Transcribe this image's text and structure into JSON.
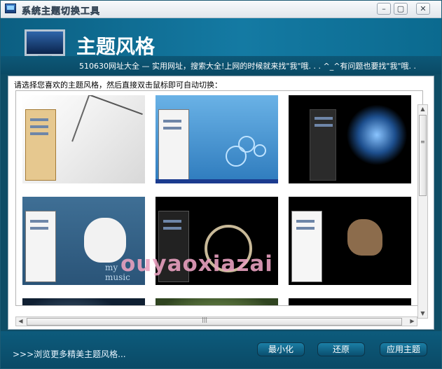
{
  "window": {
    "title": "系统主题切换工具",
    "controls": {
      "minimize": "–",
      "restore": "▢",
      "close": "✕"
    }
  },
  "header": {
    "heading": "主题风格",
    "marquee": "510630网址大全 — 实用网址，搜索大全!上网的时候就来找\"我\"哦. . . ^_^有问题也要找\"我\"哦. .",
    "icon": "monitor-icon"
  },
  "main": {
    "instruction": "请选择您喜欢的主题风格，然后直接双击鼠标即可自动切换：",
    "themes": [
      {
        "name": "theme-ink-painting"
      },
      {
        "name": "theme-blue-bubbles"
      },
      {
        "name": "theme-earth-space"
      },
      {
        "name": "theme-my-music",
        "label": "my music"
      },
      {
        "name": "theme-dark-ring"
      },
      {
        "name": "theme-dark-art"
      },
      {
        "name": "theme-row3-1"
      },
      {
        "name": "theme-row3-2"
      },
      {
        "name": "theme-row3-3"
      }
    ],
    "watermark": "ouyaoxiazai"
  },
  "footer": {
    "browse_link": ">>>浏览更多精美主题风格...",
    "buttons": {
      "minimize": "最小化",
      "restore": "还原",
      "apply": "应用主题"
    }
  },
  "colors": {
    "frame": "#0e4d66",
    "header_accent": "#147aa3",
    "button": "#0a4f6f"
  }
}
